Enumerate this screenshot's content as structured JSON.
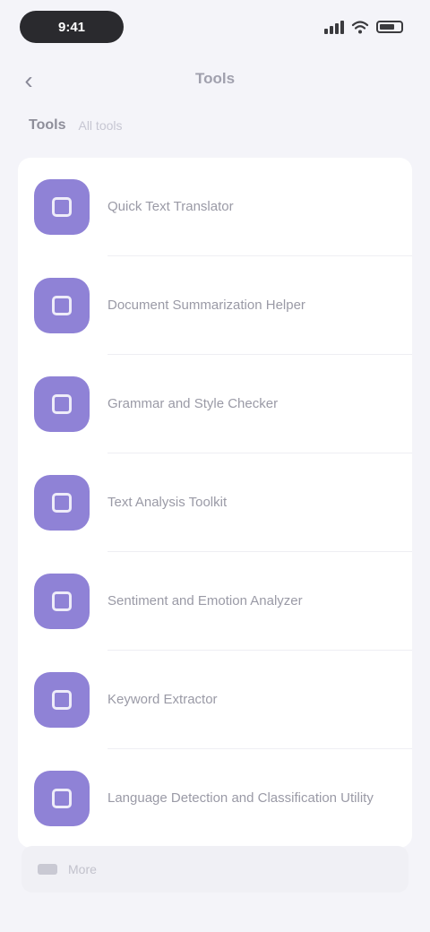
{
  "status_bar": {
    "time": "9:41"
  },
  "nav": {
    "back_icon": "chevron-left-icon",
    "title": "Tools"
  },
  "section": {
    "title": "Tools",
    "subtitle": "All tools"
  },
  "colors": {
    "accent": "#8f82d6",
    "background": "#f4f4f9",
    "card": "#ffffff"
  },
  "items": [
    {
      "label": "Quick Text Translator",
      "icon": "translate-icon"
    },
    {
      "label": "Document Summarization Helper",
      "icon": "document-icon"
    },
    {
      "label": "Grammar and Style Checker",
      "icon": "grammar-icon"
    },
    {
      "label": "Text Analysis Toolkit",
      "icon": "analysis-icon"
    },
    {
      "label": "Sentiment and Emotion Analyzer",
      "icon": "sentiment-icon"
    },
    {
      "label": "Keyword Extractor",
      "icon": "keyword-icon"
    },
    {
      "label": "Language Detection and Classification Utility",
      "icon": "language-icon"
    }
  ],
  "footer": {
    "label": "More"
  }
}
